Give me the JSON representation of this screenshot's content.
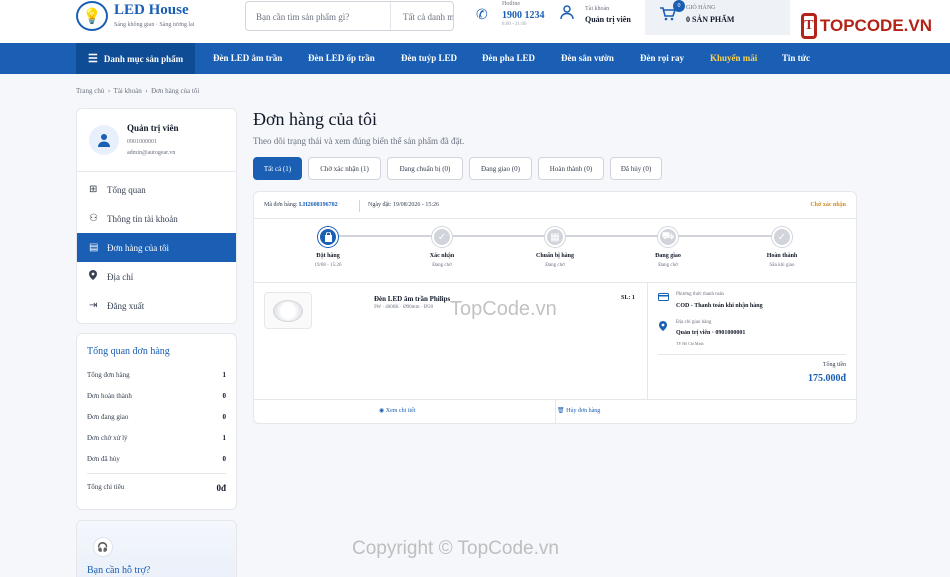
{
  "header": {
    "brand": "LED House",
    "tagline": "Sáng không gian · Sáng tương lai",
    "search_placeholder": "Bạn cần tìm sản phẩm gì?",
    "search_category": "Tất cả danh m",
    "hotline_label": "Hotline",
    "hotline_number": "1900 1234",
    "hotline_hours": "8:00 - 21:00",
    "account_label": "Tài khoản",
    "account_name": "Quản trị viên",
    "cart_count": "0",
    "cart_label": "GIỎ HÀNG",
    "cart_value": "0 SẢN PHẨM"
  },
  "nav": {
    "category": "Danh mục sản phẩm",
    "items": [
      "Đèn LED âm trần",
      "Đèn LED ốp trần",
      "Đèn tuýp LED",
      "Đèn pha LED",
      "Đèn sân vườn",
      "Đèn rọi ray",
      "Khuyến mãi",
      "Tin tức"
    ]
  },
  "breadcrumb": [
    "Trang chủ",
    "Tài khoản",
    "Đơn hàng của tôi"
  ],
  "profile": {
    "name": "Quản trị viên",
    "phone": "0901000001",
    "email": "admin@autogear.vn"
  },
  "menu": [
    "Tổng quan",
    "Thông tin tài khoản",
    "Đơn hàng của tôi",
    "Địa chỉ",
    "Đăng xuất"
  ],
  "stats": {
    "title": "Tổng quan đơn hàng",
    "rows": [
      {
        "label": "Tổng đơn hàng",
        "value": "1"
      },
      {
        "label": "Đơn hoàn thành",
        "value": "0"
      },
      {
        "label": "Đơn đang giao",
        "value": "0"
      },
      {
        "label": "Đơn chờ xử lý",
        "value": "1"
      },
      {
        "label": "Đơn đã hủy",
        "value": "0"
      }
    ],
    "spend_label": "Tổng chi tiêu",
    "spend_value": "0đ"
  },
  "support": {
    "title": "Bạn cần hỗ trợ?"
  },
  "page": {
    "title": "Đơn hàng của tôi",
    "subtitle": "Theo dõi trạng thái và xem đúng biến thể sản phẩm đã đặt."
  },
  "tabs": [
    "Tất cả (1)",
    "Chờ xác nhận (1)",
    "Đang chuẩn bị (0)",
    "Đang giao (0)",
    "Hoàn thành (0)",
    "Đã hủy (0)"
  ],
  "order": {
    "code_label": "Mã đơn hàng:",
    "code": "LH2608196702",
    "date": "Ngày đặt: 19/08/2026 - 15:26",
    "status": "Chờ xác nhận",
    "steps": [
      {
        "label": "Đặt hàng",
        "sub": "19/08 - 15:26"
      },
      {
        "label": "Xác nhận",
        "sub": "Đang chờ"
      },
      {
        "label": "Chuẩn bị hàng",
        "sub": "Đang chờ"
      },
      {
        "label": "Đang giao",
        "sub": "Đang chờ"
      },
      {
        "label": "Hoàn thành",
        "sub": "Sẵn khi giao"
      }
    ],
    "completed_steps": 1,
    "product_name": "Đèn LED âm trần Philips",
    "product_spec": "9W · 4000K · Ø90mm · IP20",
    "qty": "SL: 1",
    "payment_label": "Phương thức thanh toán",
    "payment_value": "COD - Thanh toán khi nhận hàng",
    "address_label": "Địa chỉ giao hàng",
    "address_name": "Quản trị viên · 0901000001",
    "address_city": "TP. Hồ Chí Minh",
    "total_label": "Tổng tiền",
    "total_value": "175.000đ",
    "view_detail": "Xem chi tiết",
    "cancel": "Hủy đơn hàng"
  },
  "watermark": {
    "logo_text": "TOPCODE.VN",
    "center": "TopCode.vn",
    "copyright": "Copyright © TopCode.vn"
  }
}
